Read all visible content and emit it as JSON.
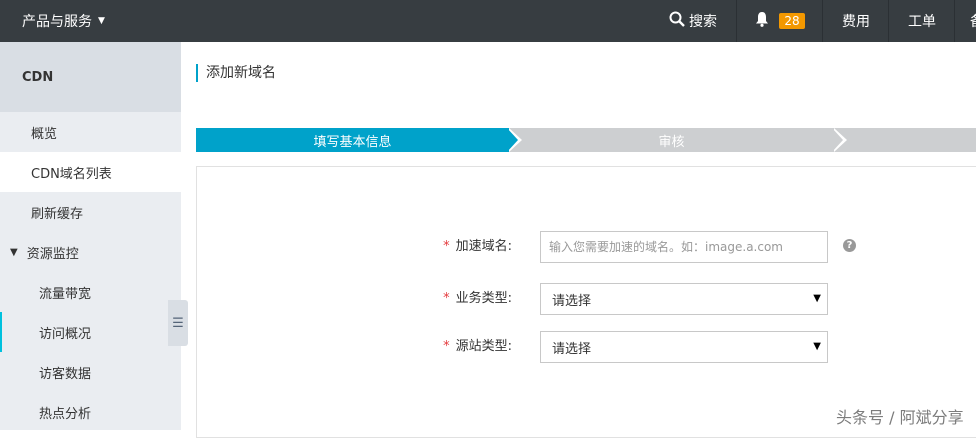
{
  "topbar": {
    "brand": "产品与服务",
    "search": "搜索",
    "badge": "28",
    "fee": "费用",
    "order": "工单",
    "more": "备"
  },
  "sidebar": {
    "title": "CDN",
    "items": [
      {
        "label": "概览"
      },
      {
        "label": "CDN域名列表"
      },
      {
        "label": "刷新缓存"
      },
      {
        "label": "资源监控"
      },
      {
        "label": "流量带宽"
      },
      {
        "label": "访问概况"
      },
      {
        "label": "访客数据"
      },
      {
        "label": "热点分析"
      }
    ]
  },
  "main": {
    "title": "添加新域名",
    "steps": [
      {
        "label": "填写基本信息"
      },
      {
        "label": "审核"
      },
      {
        "label": ""
      }
    ],
    "form": {
      "domain_label": "加速域名:",
      "domain_placeholder": "输入您需要加速的域名。如：image.a.com",
      "business_label": "业务类型:",
      "business_value": "请选择",
      "origin_label": "源站类型:",
      "origin_value": "请选择",
      "required_mark": "*"
    }
  },
  "watermark": "头条号 / 阿斌分享",
  "colors": {
    "topbar": "#373d41",
    "accent": "#00a2ca",
    "badge": "#f39800",
    "sidebar": "#eaedf1"
  }
}
